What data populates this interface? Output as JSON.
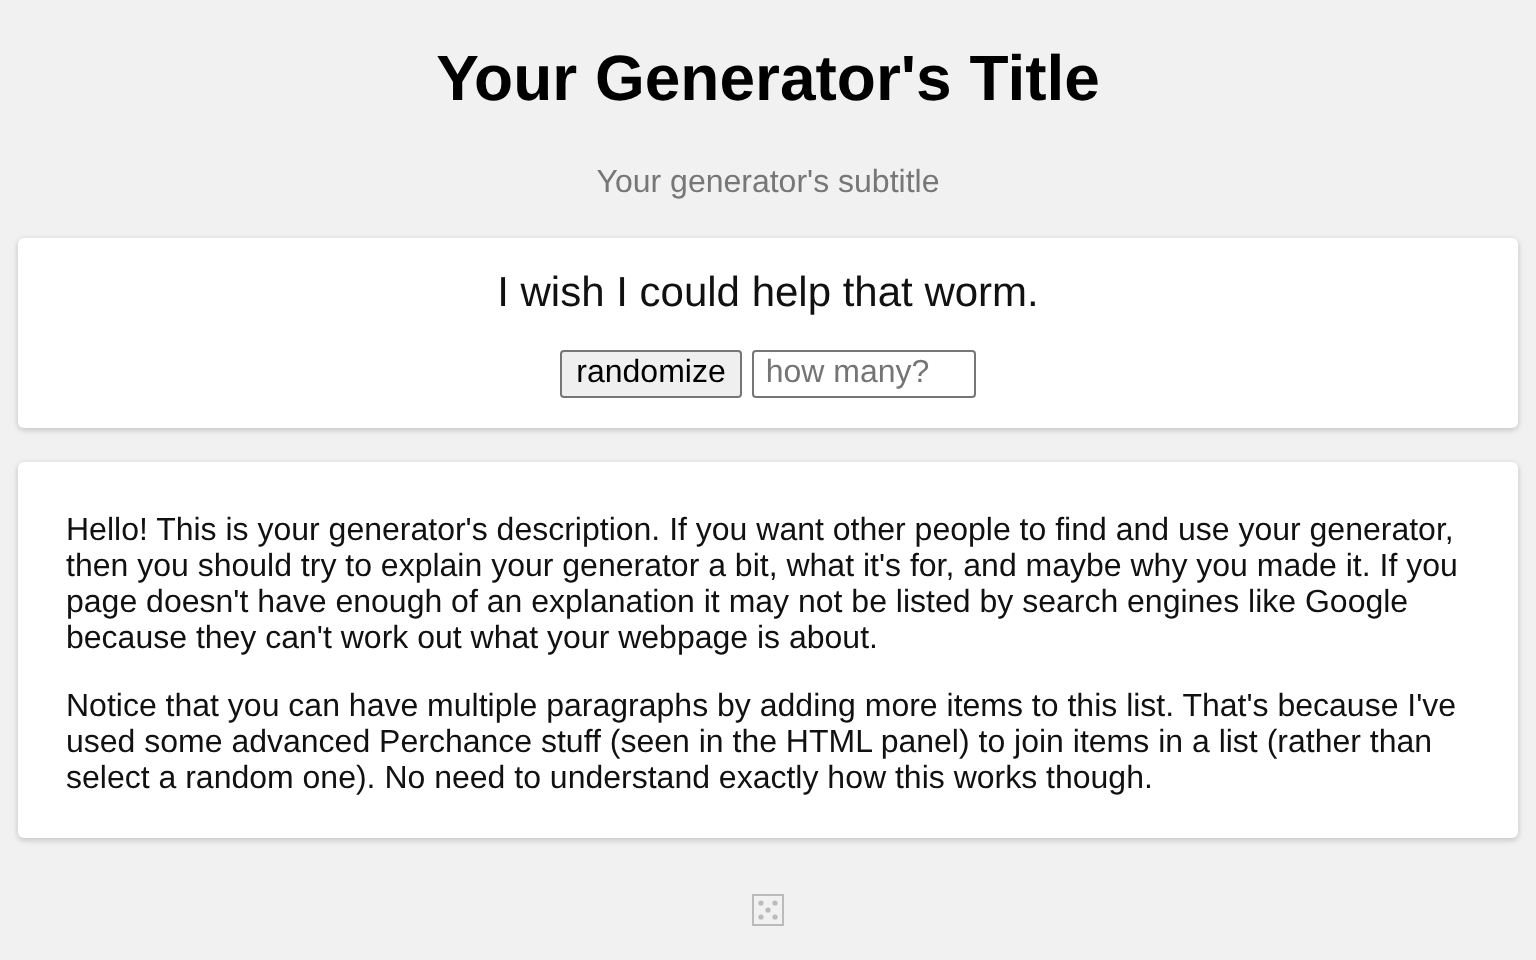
{
  "title": "Your Generator's Title",
  "subtitle": "Your generator's subtitle",
  "output": "I wish I could help that worm.",
  "randomize_button": "randomize",
  "count_field": {
    "placeholder": "how many?"
  },
  "description": [
    "Hello! This is your generator's description. If you want other people to find and use your generator, then you should try to explain your generator a bit, what it's for, and maybe why you made it. If you page doesn't have enough of an explanation it may not be listed by search engines like Google because they can't work out what your webpage is about.",
    "Notice that you can have multiple paragraphs by adding more items to this list. That's because I've used some advanced Perchance stuff (seen in the HTML panel) to join items in a list (rather than select a random one). No need to understand exactly how this works though."
  ]
}
